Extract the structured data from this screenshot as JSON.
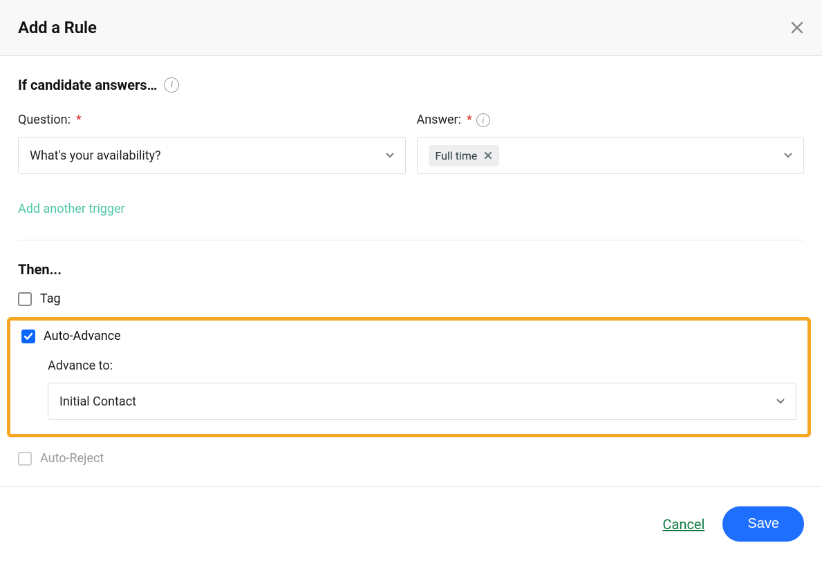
{
  "header": {
    "title": "Add a Rule"
  },
  "trigger": {
    "section_title": "If candidate answers…",
    "question_label": "Question:",
    "question_value": "What's your availability?",
    "answer_label": "Answer:",
    "answer_tag": "Full time",
    "add_another": "Add another trigger"
  },
  "then": {
    "section_title": "Then...",
    "tag_label": "Tag",
    "auto_advance_label": "Auto-Advance",
    "advance_to_label": "Advance to:",
    "advance_to_value": "Initial Contact",
    "auto_reject_label": "Auto-Reject"
  },
  "footer": {
    "cancel": "Cancel",
    "save": "Save"
  }
}
